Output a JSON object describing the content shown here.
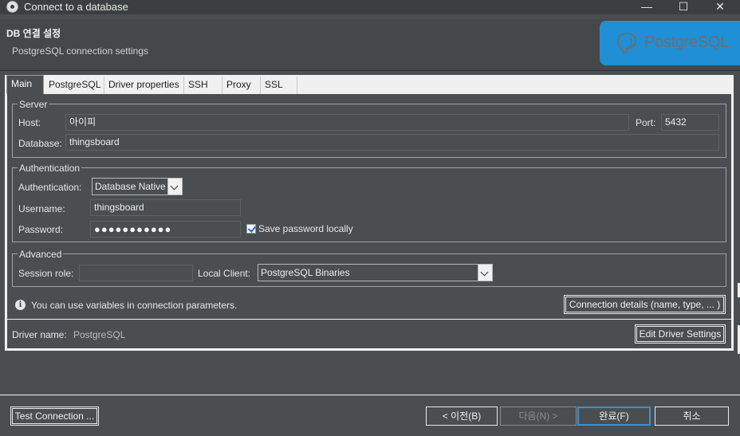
{
  "window": {
    "title": "Connect to a database",
    "minimize": "—",
    "maximize": "☐",
    "close": "✕"
  },
  "header": {
    "title": "DB 연결 설정",
    "subtitle": "PostgreSQL connection settings",
    "logo_text": "PostgreSQL"
  },
  "tabs": [
    {
      "label": "Main",
      "active": true
    },
    {
      "label": "PostgreSQL"
    },
    {
      "label": "Driver properties"
    },
    {
      "label": "SSH"
    },
    {
      "label": "Proxy"
    },
    {
      "label": "SSL"
    }
  ],
  "server": {
    "group_label": "Server",
    "host_label": "Host:",
    "host_value": "아이피",
    "port_label": "Port:",
    "port_value": "5432",
    "database_label": "Database:",
    "database_value": "thingsboard"
  },
  "auth": {
    "group_label": "Authentication",
    "auth_label": "Authentication:",
    "auth_value": "Database Native",
    "username_label": "Username:",
    "username_value": "thingsboard",
    "password_label": "Password:",
    "password_value": "●●●●●●●●●●●",
    "save_password_label": "Save password locally",
    "save_password_checked": true
  },
  "advanced": {
    "group_label": "Advanced",
    "session_role_label": "Session role:",
    "session_role_value": "",
    "local_client_label": "Local Client:",
    "local_client_value": "PostgreSQL Binaries"
  },
  "info": {
    "text": "You can use variables in connection parameters.",
    "connection_details_button": "Connection details (name, type, ... )"
  },
  "driver": {
    "label": "Driver name:",
    "value": "PostgreSQL",
    "edit_button": "Edit Driver Settings"
  },
  "footer": {
    "test_connection": "Test Connection ...",
    "back": "< 이전(B)",
    "next": "다음(N) >",
    "finish": "완료(F)",
    "cancel": "취소"
  }
}
